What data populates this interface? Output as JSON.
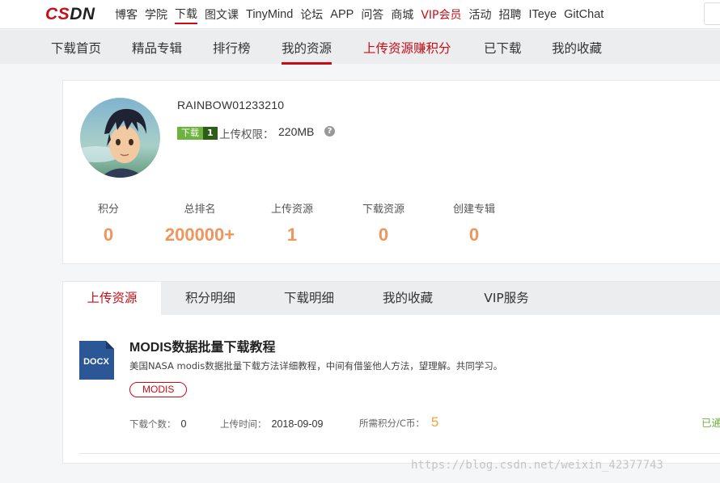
{
  "topnav": {
    "logo": "CSDN",
    "items": [
      "博客",
      "学院",
      "下载",
      "图文课",
      "TinyMind",
      "论坛",
      "APP",
      "问答",
      "商城",
      "VIP会员",
      "活动",
      "招聘",
      "ITeye",
      "GitChat"
    ]
  },
  "subnav": {
    "items": [
      "下载首页",
      "精品专辑",
      "排行榜",
      "我的资源",
      "上传资源赚积分",
      "已下载",
      "我的收藏"
    ]
  },
  "profile": {
    "username": "RAINBOW01233210",
    "badge_label": "下载",
    "badge_level": "1",
    "quota_label": "上传权限：",
    "quota_value": "220MB",
    "help": "?",
    "stats": [
      {
        "label": "积分",
        "value": "0"
      },
      {
        "label": "总排名",
        "value": "200000+"
      },
      {
        "label": "上传资源",
        "value": "1"
      },
      {
        "label": "下载资源",
        "value": "0"
      },
      {
        "label": "创建专辑",
        "value": "0"
      }
    ]
  },
  "tabs": [
    "上传资源",
    "积分明细",
    "下载明细",
    "我的收藏",
    "VIP服务"
  ],
  "resource": {
    "icon_label": "DOCX",
    "title_latin": "MODIS",
    "title_rest": "数据批量下载教程",
    "description": "美国NASA modis数据批量下载方法详细教程，中间有借鉴他人方法，望理解。共同学习。",
    "tag": "MODIS",
    "downloads_label": "下载个数：",
    "downloads_value": "0",
    "upload_time_label": "上传时间：",
    "upload_time_value": "2018-09-09",
    "points_label": "所需积分/C币：",
    "points_value": "5",
    "status": "已通"
  },
  "watermark": "https://blog.csdn.net/weixin_42377743",
  "colors": {
    "brand": "#ca0c16",
    "stat": "#f0955b",
    "points": "#f0a23c",
    "green": "#6db33f"
  }
}
